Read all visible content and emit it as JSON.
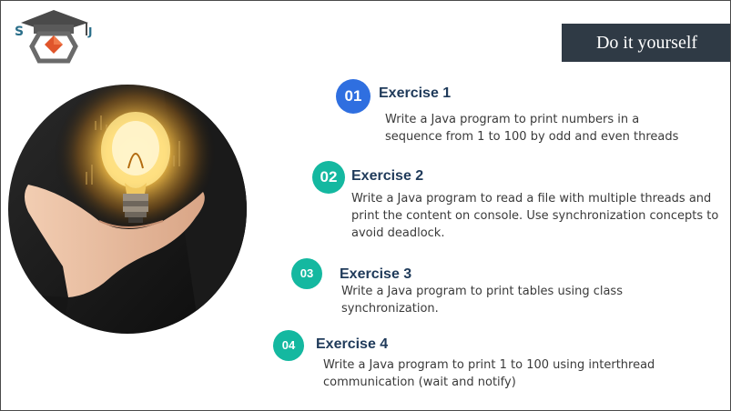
{
  "banner": {
    "title": "Do it yourself"
  },
  "colors": {
    "banner_bg": "#2f3a45",
    "badge_blue": "#2f6fe0",
    "badge_teal": "#14b8a0",
    "title_text": "#1f3a5a",
    "body_text": "#3a3a3a"
  },
  "logo": {
    "icon": "graduation-cap-logo-icon"
  },
  "photo": {
    "icon": "light-bulb-in-hand-photo"
  },
  "exercises": [
    {
      "number": "01",
      "title": "Exercise 1",
      "description": "Write a Java program to print numbers in a sequence from 1 to 100 by odd and even threads"
    },
    {
      "number": "02",
      "title": "Exercise 2",
      "description": "Write a Java program to read a file with multiple threads and print the content on console. Use synchronization concepts to avoid deadlock."
    },
    {
      "number": "03",
      "title": "Exercise 3",
      "description": "Write a Java program to print tables using class synchronization."
    },
    {
      "number": "04",
      "title": "Exercise 4",
      "description": "Write a Java program to print 1 to 100 using interthread communication (wait and notify)"
    }
  ]
}
